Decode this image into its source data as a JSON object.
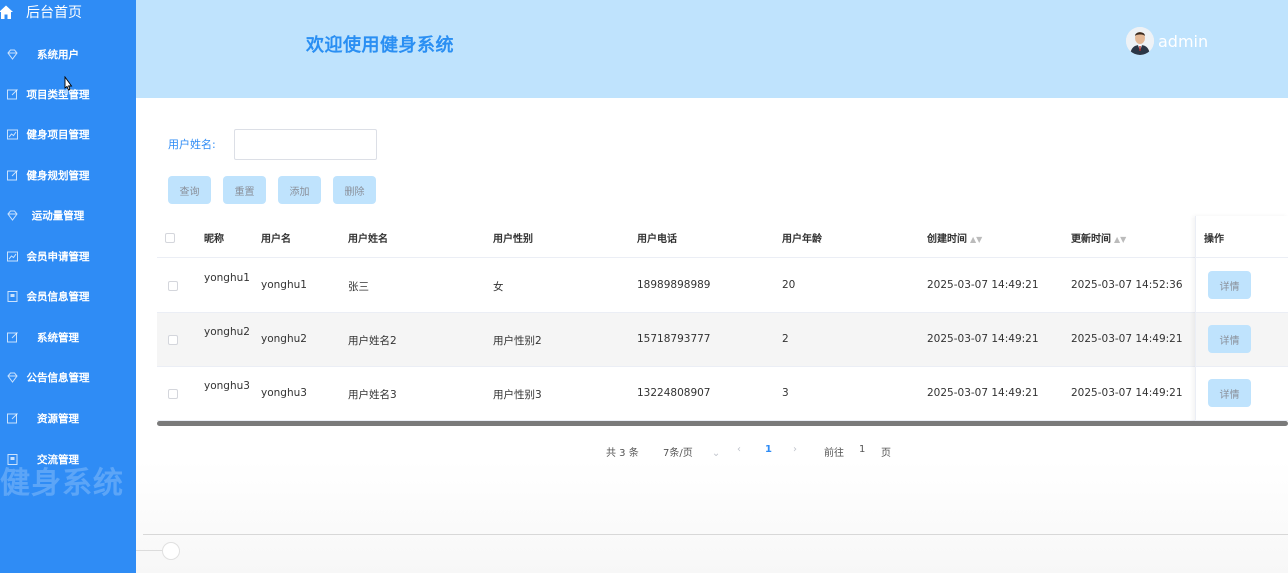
{
  "sidebar": {
    "home_label": "后台首页",
    "items": [
      {
        "label": "系统用户",
        "icon": "diamond-icon"
      },
      {
        "label": "项目类型管理",
        "icon": "edit-icon"
      },
      {
        "label": "健身项目管理",
        "icon": "chart-icon"
      },
      {
        "label": "健身规划管理",
        "icon": "edit-icon"
      },
      {
        "label": "运动量管理",
        "icon": "diamond-icon"
      },
      {
        "label": "会员申请管理",
        "icon": "chart-icon"
      },
      {
        "label": "会员信息管理",
        "icon": "document-icon"
      },
      {
        "label": "系统管理",
        "icon": "edit-icon"
      },
      {
        "label": "公告信息管理",
        "icon": "diamond-icon"
      },
      {
        "label": "资源管理",
        "icon": "edit-icon"
      },
      {
        "label": "交流管理",
        "icon": "document-icon"
      }
    ],
    "watermark": "健身系统"
  },
  "header": {
    "title": "欢迎使用健身系统",
    "username": "admin"
  },
  "search": {
    "label": "用户姓名:",
    "value": "",
    "placeholder": ""
  },
  "buttons": {
    "query": "查询",
    "reset": "重置",
    "add": "添加",
    "delete": "删除"
  },
  "table": {
    "columns": [
      "昵称",
      "用户名",
      "用户姓名",
      "用户性别",
      "用户电话",
      "用户年龄",
      "创建时间",
      "更新时间",
      "操作"
    ],
    "rows": [
      {
        "nickname": "yonghu1",
        "username": "yonghu1",
        "name": "张三",
        "gender": "女",
        "phone": "18989898989",
        "age": "20",
        "created": "2025-03-07 14:49:21",
        "updated": "2025-03-07 14:52:36",
        "action": "详情"
      },
      {
        "nickname": "yonghu2",
        "username": "yonghu2",
        "name": "用户姓名2",
        "gender": "用户性别2",
        "phone": "15718793777",
        "age": "2",
        "created": "2025-03-07 14:49:21",
        "updated": "2025-03-07 14:49:21",
        "action": "详情"
      },
      {
        "nickname": "yonghu3",
        "username": "yonghu3",
        "name": "用户姓名3",
        "gender": "用户性别3",
        "phone": "13224808907",
        "age": "3",
        "created": "2025-03-07 14:49:21",
        "updated": "2025-03-07 14:49:21",
        "action": "详情"
      }
    ]
  },
  "pagination": {
    "total": "共 3 条",
    "page_size": "7条/页",
    "current_page": "1",
    "goto_prefix": "前往",
    "goto_value": "1",
    "goto_suffix": "页"
  },
  "colors": {
    "sidebar_bg": "#2f8cf5",
    "header_bg": "#bfe3fd",
    "accent": "#2a8ff3",
    "button_bg": "#bfe3fd"
  }
}
